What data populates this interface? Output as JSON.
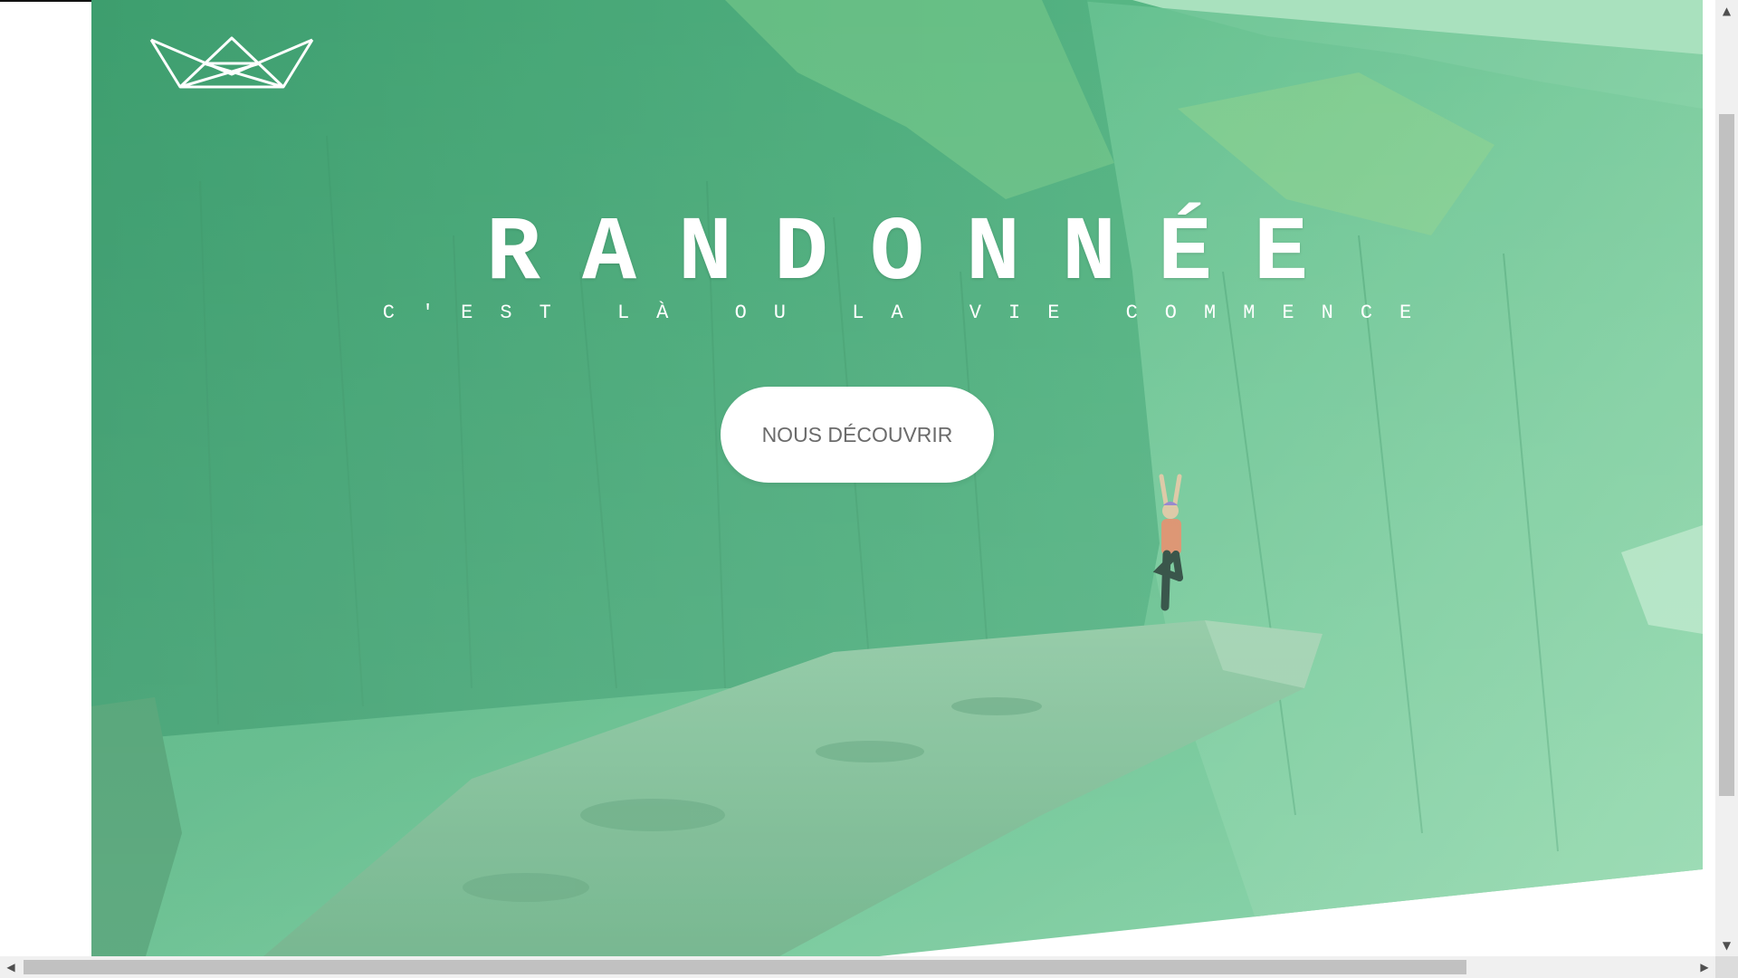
{
  "hero": {
    "title": "RANDONNÉE",
    "subtitle": "C'EST LÀ OU LA VIE COMMENCE",
    "cta_label": "NOUS DÉCOUVRIR",
    "overlay_color": "#3fbf86",
    "text_color": "#ffffff",
    "button_text_color": "#6b6b6b"
  },
  "logo": {
    "icon": "crown-outline-icon",
    "color": "#ffffff"
  },
  "scrollbars": {
    "vertical": {
      "up_glyph": "▲",
      "down_glyph": "▼"
    },
    "horizontal": {
      "left_glyph": "◀",
      "right_glyph": "▶"
    }
  }
}
